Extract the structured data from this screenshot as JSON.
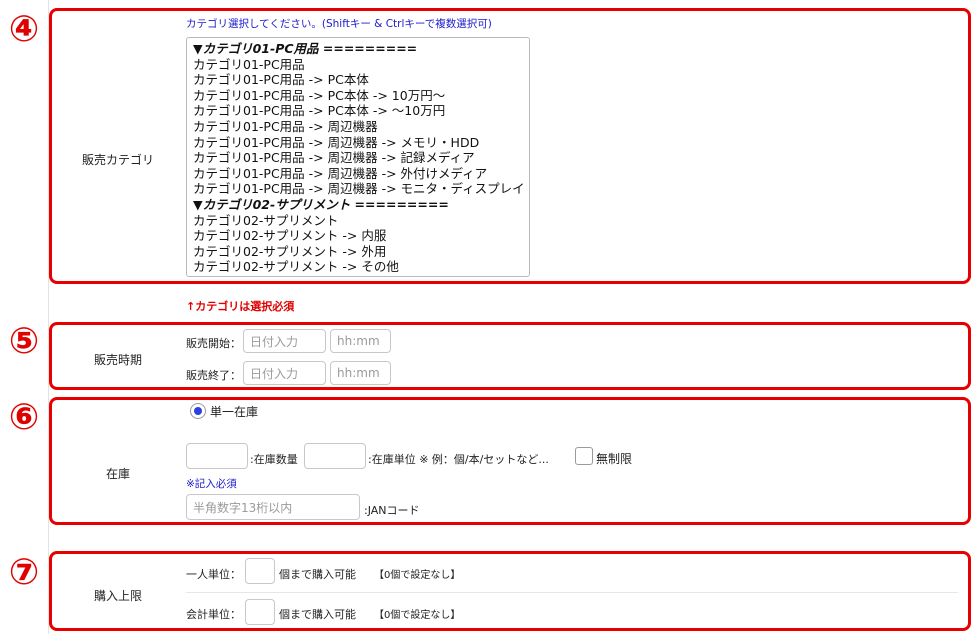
{
  "markers": [
    "④",
    "⑤",
    "⑥",
    "⑦"
  ],
  "category": {
    "label": "販売カテゴリ",
    "hint": "カテゴリ選択してください。(Shiftキー & Ctrlキーで複数選択可)",
    "required_note": "↑カテゴリは選択必須",
    "options": [
      {
        "text": "▼カテゴリ01-PC用品 =========",
        "group": true
      },
      {
        "text": "カテゴリ01-PC用品",
        "group": false
      },
      {
        "text": "カテゴリ01-PC用品 -> PC本体",
        "group": false
      },
      {
        "text": "カテゴリ01-PC用品 -> PC本体 -> 10万円〜",
        "group": false
      },
      {
        "text": "カテゴリ01-PC用品 -> PC本体 -> 〜10万円",
        "group": false
      },
      {
        "text": "カテゴリ01-PC用品 -> 周辺機器",
        "group": false
      },
      {
        "text": "カテゴリ01-PC用品 -> 周辺機器 -> メモリ・HDD",
        "group": false
      },
      {
        "text": "カテゴリ01-PC用品 -> 周辺機器 -> 記録メディア",
        "group": false
      },
      {
        "text": "カテゴリ01-PC用品 -> 周辺機器 -> 外付けメディア",
        "group": false
      },
      {
        "text": "カテゴリ01-PC用品 -> 周辺機器 -> モニタ・ディスプレイ",
        "group": false
      },
      {
        "text": "▼カテゴリ02-サプリメント =========",
        "group": true
      },
      {
        "text": "カテゴリ02-サプリメント",
        "group": false
      },
      {
        "text": "カテゴリ02-サプリメント -> 内服",
        "group": false
      },
      {
        "text": "カテゴリ02-サプリメント -> 外用",
        "group": false
      },
      {
        "text": "カテゴリ02-サプリメント -> その他",
        "group": false
      }
    ]
  },
  "period": {
    "label": "販売時期",
    "start_label": "販売開始：",
    "end_label": "販売終了：",
    "date_placeholder": "日付入力",
    "time_placeholder": "hh:mm"
  },
  "stock": {
    "label": "在庫",
    "radio_label": "単一在庫",
    "qty_label": ":在庫数量",
    "unit_label": ":在庫単位 ※ 例：個/本/セットなど...",
    "unlimited_label": "無制限",
    "required_note": "※記入必須",
    "jan_placeholder": "半角数字13桁以内",
    "jan_label": ":JANコード"
  },
  "purchase_limit": {
    "label": "購入上限",
    "per_person_label": "一人単位：",
    "per_person_suffix": "個まで購入可能",
    "per_person_note": "【0個で設定なし】",
    "total_label": "会計単位：",
    "total_suffix": "個まで購入可能",
    "total_note": "【0個で設定なし】"
  },
  "colors": {
    "highlight": "#e60000",
    "hint_blue": "#1a1acc",
    "radio_selected": "#2c3fe0"
  }
}
